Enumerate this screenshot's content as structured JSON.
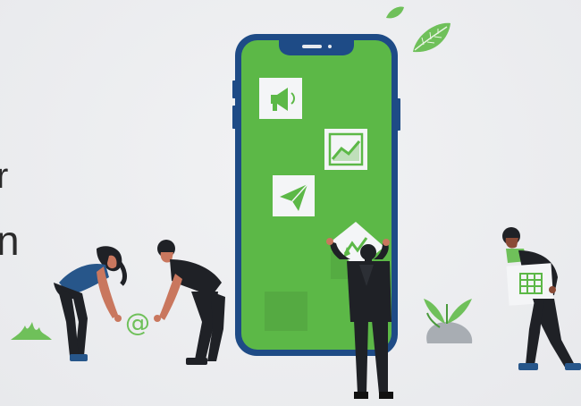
{
  "partial_text": {
    "line1": "r",
    "line2": "n"
  },
  "icons": [
    "megaphone-icon",
    "chart-icon",
    "paper-plane-icon",
    "at-sign-icon",
    "spreadsheet-icon",
    "leaf-icon"
  ],
  "at_symbol": "@",
  "colors": {
    "phone_screen": "#5cb847",
    "phone_frame": "#1e4b86",
    "background": "#ecedf0",
    "leaf": "#6fc05a",
    "dark_clothing": "#1f2126",
    "shirt_blue": "#27568a",
    "skin": "#c9775e"
  }
}
